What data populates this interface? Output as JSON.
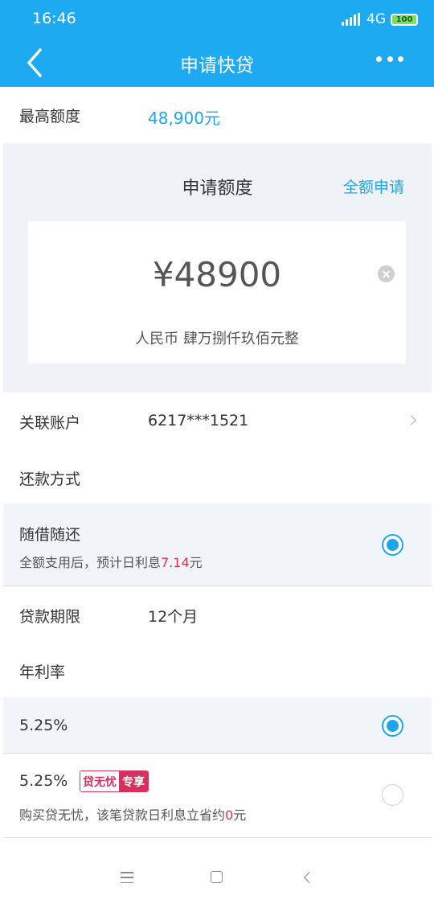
{
  "status_bar": {
    "time": "16:46",
    "network": "4G",
    "battery": "100"
  },
  "header": {
    "title": "申请快贷"
  },
  "max_quota": {
    "label": "最高额度",
    "value": "48,900元"
  },
  "quota": {
    "title": "申请额度",
    "full_apply": "全额申请",
    "amount": "¥48900",
    "amount_words": "人民币  肆万捌仟玖佰元整"
  },
  "linked_account": {
    "label": "关联账户",
    "value": "6217***1521"
  },
  "repayment": {
    "label": "还款方式",
    "option": {
      "title": "随借随还",
      "sub_prefix": "全额支用后，预计日利息",
      "sub_amount": "7.14",
      "sub_suffix": "元"
    }
  },
  "term": {
    "label": "贷款期限",
    "value": "12个月"
  },
  "rate": {
    "label": "年利率",
    "options": [
      {
        "title": "5.25%"
      },
      {
        "title": "5.25%",
        "badge_left": "贷无忧",
        "badge_right": "专享",
        "sub_prefix": "购买贷无忧，该笔贷款日利息立省约",
        "sub_amount": "0",
        "sub_suffix": "元"
      }
    ]
  },
  "colors": {
    "primary": "#1eaaf1",
    "accent_red": "#e0344a",
    "badge": "#d6305c"
  }
}
